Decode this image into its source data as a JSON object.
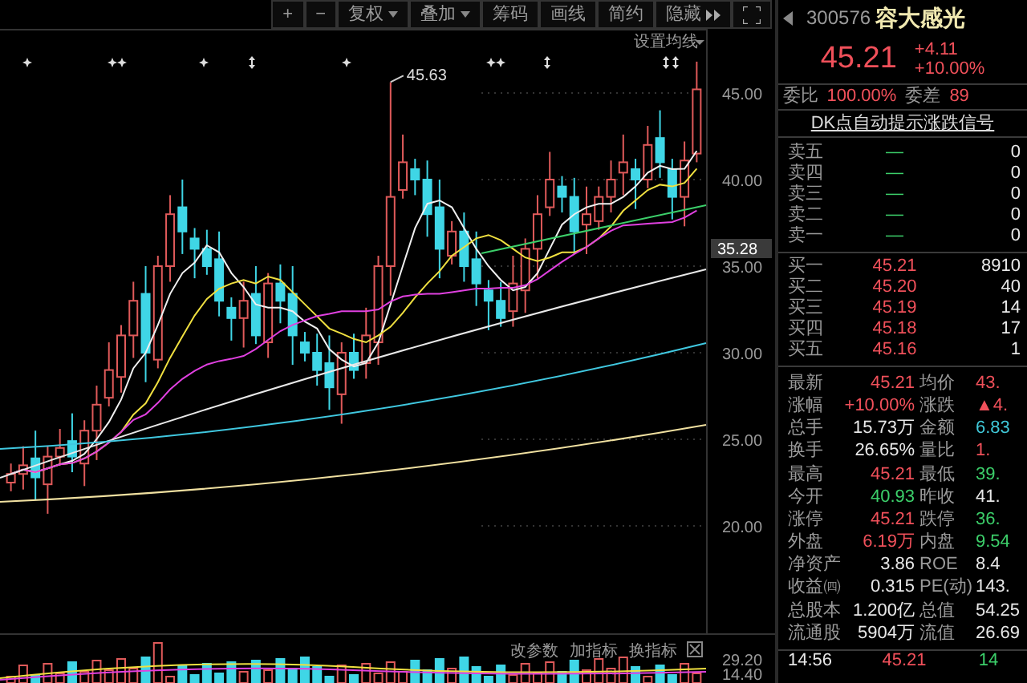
{
  "toolbar": [
    {
      "label": "+",
      "kind": "plain"
    },
    {
      "label": "−",
      "kind": "plain"
    },
    {
      "label": "复权",
      "kind": "dropdown"
    },
    {
      "label": "叠加",
      "kind": "dropdown"
    },
    {
      "label": "筹码",
      "kind": "plain"
    },
    {
      "label": "画线",
      "kind": "plain"
    },
    {
      "label": "简约",
      "kind": "plain"
    },
    {
      "label": "隐藏",
      "kind": "expand"
    }
  ],
  "chart": {
    "ma_setting": "设置均线",
    "peak_label": "45.63",
    "markers": [
      {
        "kind": "star"
      },
      {
        "kind": "double-star"
      },
      {
        "kind": "star"
      },
      {
        "kind": "arrows"
      },
      {
        "kind": "star"
      },
      {
        "kind": "double-star"
      },
      {
        "kind": "arrows"
      },
      {
        "kind": "double-arrows"
      }
    ],
    "y_axis": [
      {
        "label": "45.00",
        "kind": "tick"
      },
      {
        "label": "40.00",
        "kind": "tick"
      },
      {
        "label": "35.28",
        "kind": "current"
      },
      {
        "label": "35.00",
        "kind": "tick"
      },
      {
        "label": "30.00",
        "kind": "tick"
      },
      {
        "label": "25.00",
        "kind": "tick"
      },
      {
        "label": "20.00",
        "kind": "tick"
      }
    ]
  },
  "volume_panel": {
    "buttons": [
      "改参数",
      "加指标",
      "换指标"
    ],
    "y_axis": [
      "29.20",
      "14.40"
    ]
  },
  "quote": {
    "code": "300576",
    "name": "容大感光",
    "price": "45.21",
    "change": "+4.11",
    "change_pct": "+10.00%"
  },
  "order_ratio": [
    {
      "label": "委比",
      "value": "100.00%"
    },
    {
      "label": "委差",
      "value": "89"
    }
  ],
  "signal_link": "DK点自动提示涨跌信号",
  "asks": [
    {
      "label": "卖五",
      "price": "—",
      "volume": "0"
    },
    {
      "label": "卖四",
      "price": "—",
      "volume": "0"
    },
    {
      "label": "卖三",
      "price": "—",
      "volume": "0"
    },
    {
      "label": "卖二",
      "price": "—",
      "volume": "0"
    },
    {
      "label": "卖一",
      "price": "—",
      "volume": "0"
    }
  ],
  "bids": [
    {
      "label": "买一",
      "price": "45.21",
      "volume": "8910"
    },
    {
      "label": "买二",
      "price": "45.20",
      "volume": "40"
    },
    {
      "label": "买三",
      "price": "45.19",
      "volume": "14"
    },
    {
      "label": "买四",
      "price": "45.18",
      "volume": "17"
    },
    {
      "label": "买五",
      "price": "45.16",
      "volume": "1"
    }
  ],
  "stats": [
    {
      "label": "最新",
      "value": "45.21",
      "color": "#f0505a"
    },
    {
      "label": "均价",
      "value": "43.",
      "color": "#f0505a"
    },
    {
      "label": "涨幅",
      "value": "+10.00%",
      "color": "#f0505a"
    },
    {
      "label": "涨跌",
      "value": "▲4.",
      "color": "#f0505a"
    },
    {
      "label": "总手",
      "value": "15.73万",
      "color": "#e8e8e8"
    },
    {
      "label": "金额",
      "value": "6.83",
      "color": "#40c8d8"
    },
    {
      "label": "换手",
      "value": "26.65%",
      "color": "#e8e8e8"
    },
    {
      "label": "量比",
      "value": "1.",
      "color": "#f0505a"
    },
    {
      "label": "最高",
      "value": "45.21",
      "color": "#f0505a"
    },
    {
      "label": "最低",
      "value": "39.",
      "color": "#3ccf6a"
    },
    {
      "label": "今开",
      "value": "40.93",
      "color": "#3ccf6a"
    },
    {
      "label": "昨收",
      "value": "41.",
      "color": "#e8e8e8"
    },
    {
      "label": "涨停",
      "value": "45.21",
      "color": "#f0505a"
    },
    {
      "label": "跌停",
      "value": "36.",
      "color": "#3ccf6a"
    },
    {
      "label": "外盘",
      "value": "6.19万",
      "color": "#f0505a"
    },
    {
      "label": "内盘",
      "value": "9.54",
      "color": "#3ccf6a"
    },
    {
      "label": "净资产",
      "value": "3.86",
      "color": "#e8e8e8"
    },
    {
      "label": "ROE",
      "value": "8.4",
      "color": "#e8e8e8"
    },
    {
      "label": "收益㈣",
      "value": "0.315",
      "color": "#e8e8e8"
    },
    {
      "label": "PE(动)",
      "value": "143.",
      "color": "#e8e8e8"
    },
    {
      "label": "总股本",
      "value": "1.200亿",
      "color": "#e8e8e8"
    },
    {
      "label": "总值",
      "value": "54.25",
      "color": "#e8e8e8"
    },
    {
      "label": "流通股",
      "value": "5904万",
      "color": "#e8e8e8"
    },
    {
      "label": "流值",
      "value": "26.69",
      "color": "#e8e8e8"
    }
  ],
  "ticks": [
    {
      "time": "14:56",
      "price": "45.21",
      "volume": "14"
    }
  ]
}
